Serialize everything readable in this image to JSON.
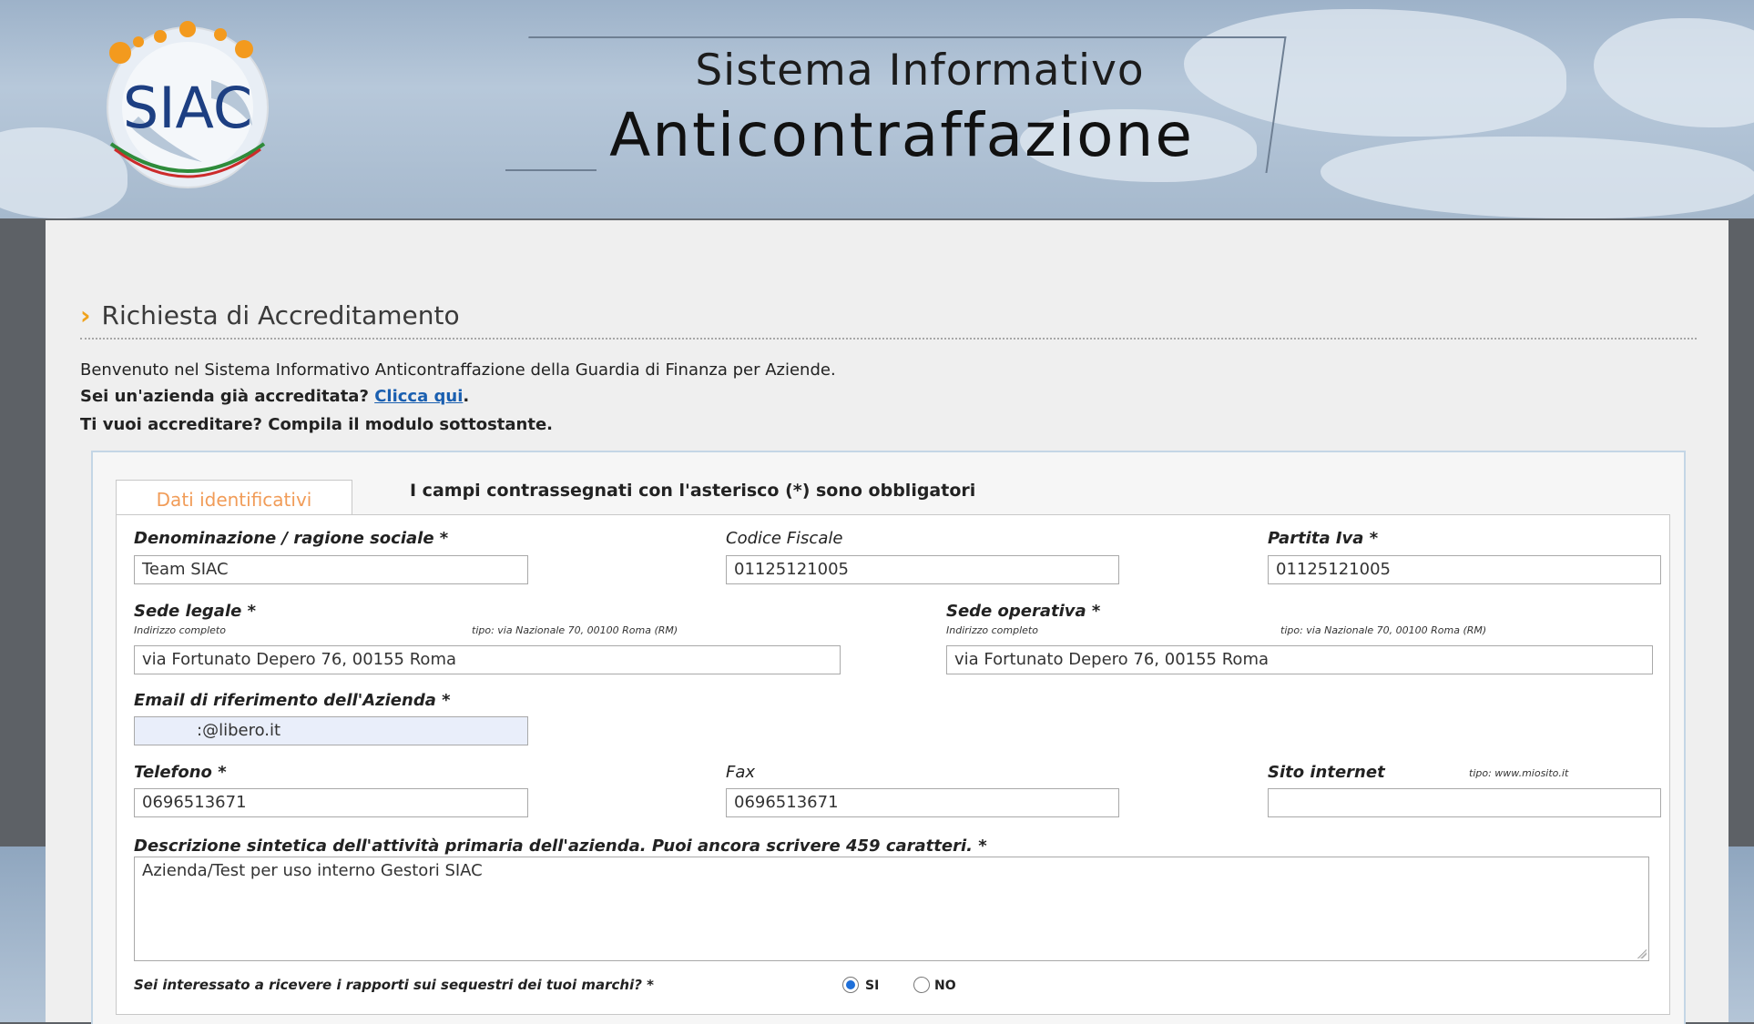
{
  "header": {
    "logo_text": "SIAC",
    "logo_ring_text": "Sistema Informativo Anticontraffazione",
    "title_line1": "Sistema Informativo",
    "title_line2": "Anticontraffazione"
  },
  "page": {
    "section_title": "Richiesta di Accreditamento",
    "intro_line1": "Benvenuto nel Sistema Informativo Anticontraffazione della Guardia di Finanza per Aziende.",
    "intro_line2_prefix": "Sei un'azienda già accreditata?",
    "intro_line2_link": "Clicca qui",
    "intro_line2_suffix": ".",
    "intro_line3": "Ti vuoi accreditare? Compila il modulo sottostante."
  },
  "form": {
    "tab_label": "Dati identificativi",
    "required_note": "I campi contrassegnati con l'asterisco (*) sono obbligatori",
    "denominazione": {
      "label": "Denominazione / ragione sociale *",
      "value": "Team SIAC"
    },
    "codice_fiscale": {
      "label": "Codice Fiscale",
      "value": "01125121005"
    },
    "partita_iva": {
      "label": "Partita Iva *",
      "value": "01125121005"
    },
    "sede_legale": {
      "label": "Sede legale *",
      "sub": "Indirizzo completo",
      "hint": "tipo: via Nazionale 70, 00100 Roma (RM)",
      "value": "via Fortunato Depero 76, 00155 Roma"
    },
    "sede_operativa": {
      "label": "Sede operativa *",
      "sub": "Indirizzo completo",
      "hint": "tipo: via Nazionale 70, 00100 Roma (RM)",
      "value": "via Fortunato Depero 76, 00155 Roma"
    },
    "email": {
      "label": "Email di riferimento dell'Azienda *",
      "value": ":@libero.it"
    },
    "telefono": {
      "label": "Telefono *",
      "value": "0696513671"
    },
    "fax": {
      "label": "Fax",
      "value": "0696513671"
    },
    "sito": {
      "label": "Sito internet",
      "hint": "tipo: www.miosito.it",
      "value": ""
    },
    "descrizione": {
      "label": "Descrizione sintetica dell'attività primaria dell'azienda. Puoi ancora scrivere 459 caratteri. *",
      "value": "Azienda/Test per uso interno Gestori SIAC"
    },
    "rapporti": {
      "question": "Sei interessato a ricevere i rapporti sui sequestri dei tuoi marchi? *",
      "option_yes": "SI",
      "option_no": "NO",
      "selected": "SI"
    }
  },
  "colors": {
    "accent_orange": "#f0a21b",
    "tab_text": "#f19c58",
    "link": "#1a5fb0",
    "radio_selected": "#1e6fd9"
  }
}
